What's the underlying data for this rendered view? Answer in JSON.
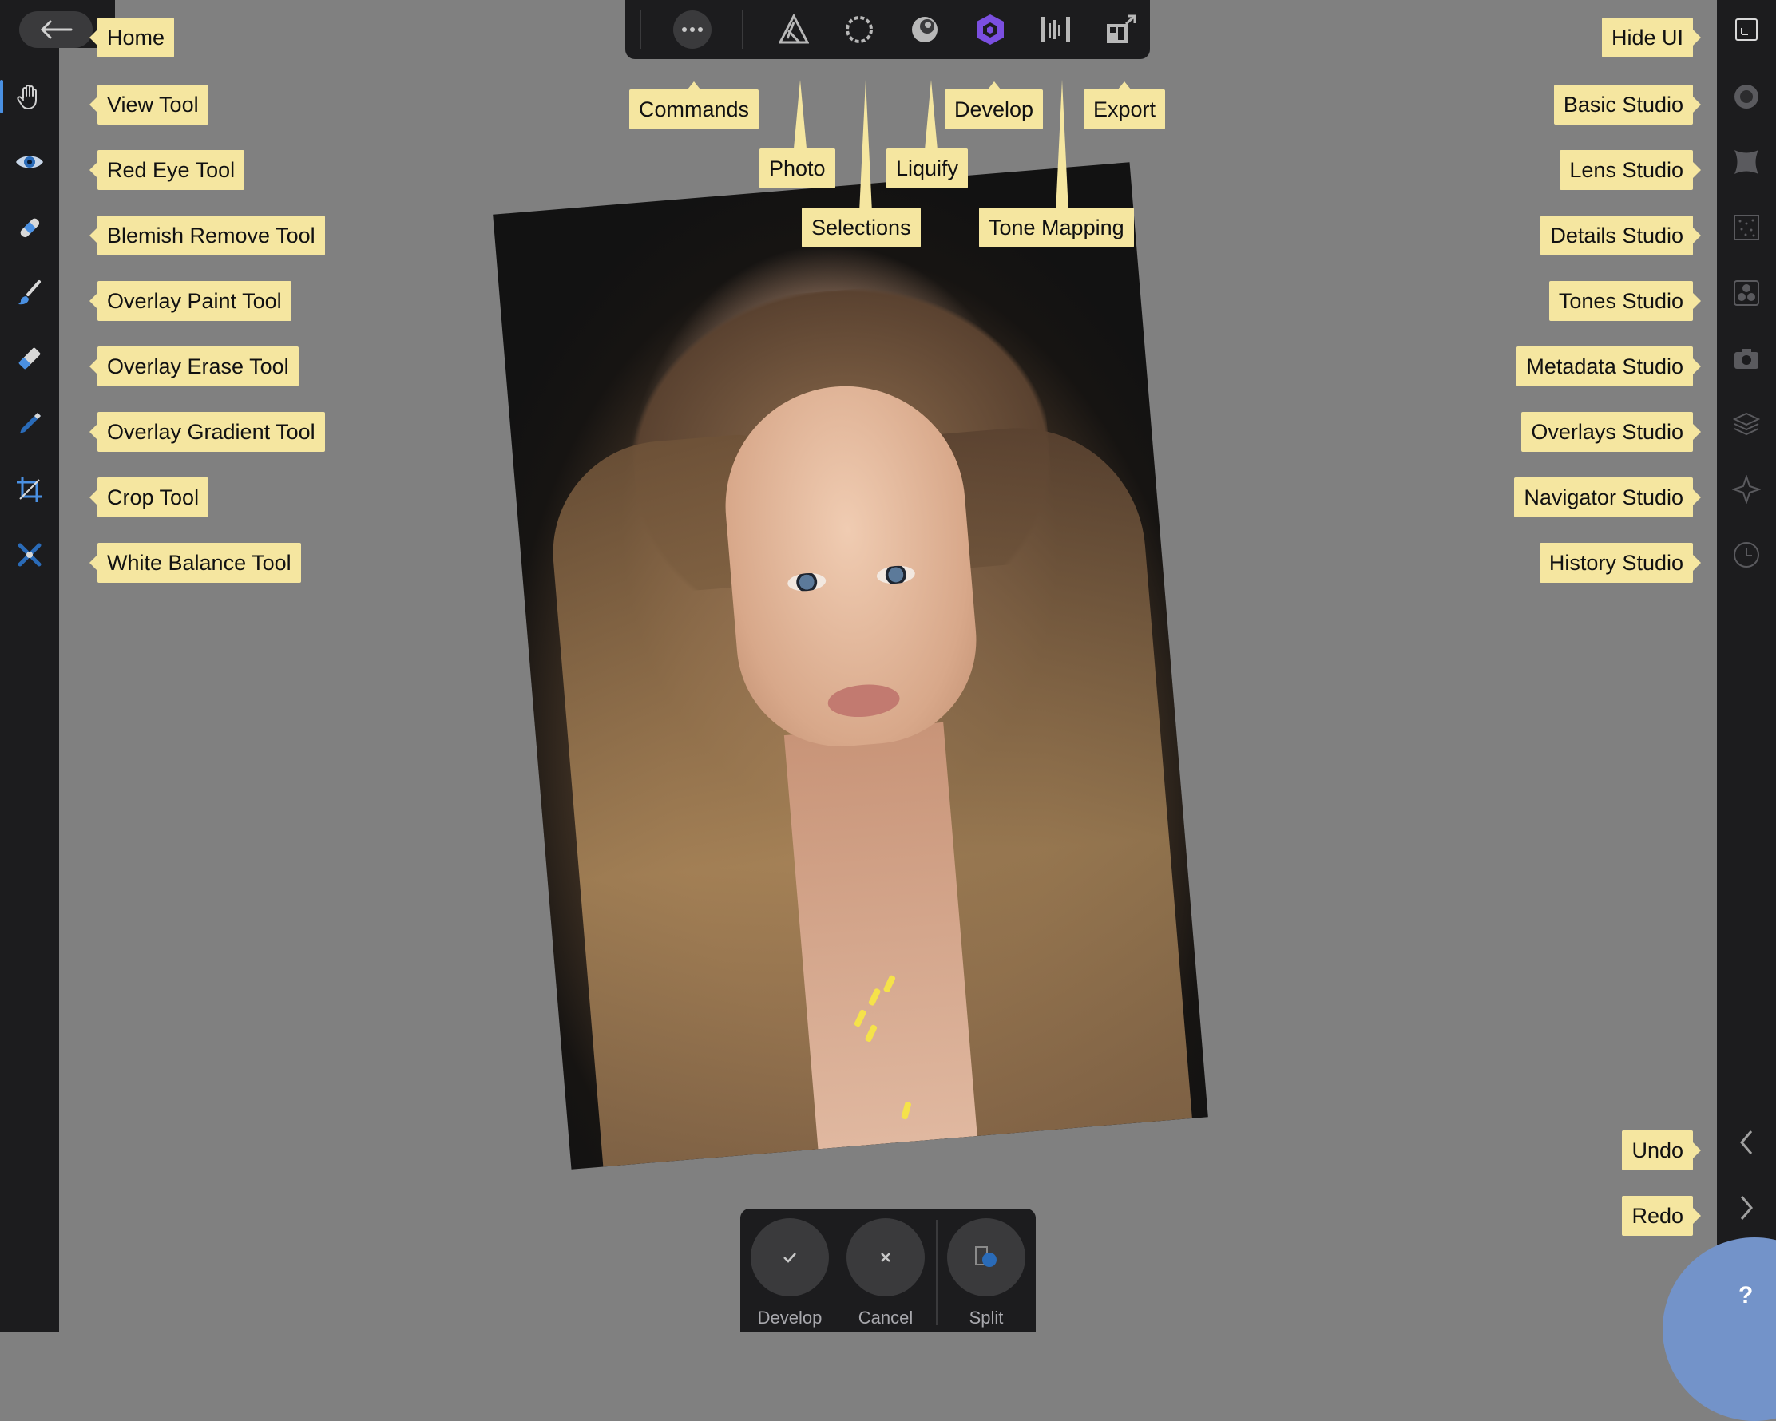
{
  "bottombar": {
    "develop": "Develop",
    "cancel": "Cancel",
    "split": "Split"
  },
  "help": "?",
  "callouts": {
    "home": "Home",
    "view": "View Tool",
    "redeye": "Red Eye Tool",
    "blemish": "Blemish Remove Tool",
    "opaint": "Overlay Paint Tool",
    "oerase": "Overlay Erase Tool",
    "ograd": "Overlay Gradient Tool",
    "crop": "Crop Tool",
    "wb": "White Balance Tool",
    "commands": "Commands",
    "photo": "Photo",
    "selections": "Selections",
    "liquify": "Liquify",
    "develop": "Develop",
    "tonemap": "Tone Mapping",
    "export": "Export",
    "hideui": "Hide UI",
    "basic": "Basic Studio",
    "lens": "Lens Studio",
    "details": "Details Studio",
    "tones": "Tones Studio",
    "metadata": "Metadata Studio",
    "overlays": "Overlays Studio",
    "navigator": "Navigator Studio",
    "history": "History Studio",
    "undo": "Undo",
    "redo": "Redo"
  },
  "colors": {
    "accent": "#4a90e2",
    "develop_active": "#7b4fe0",
    "callout_bg": "#f5e6a0",
    "help_bg": "#7393c9"
  }
}
